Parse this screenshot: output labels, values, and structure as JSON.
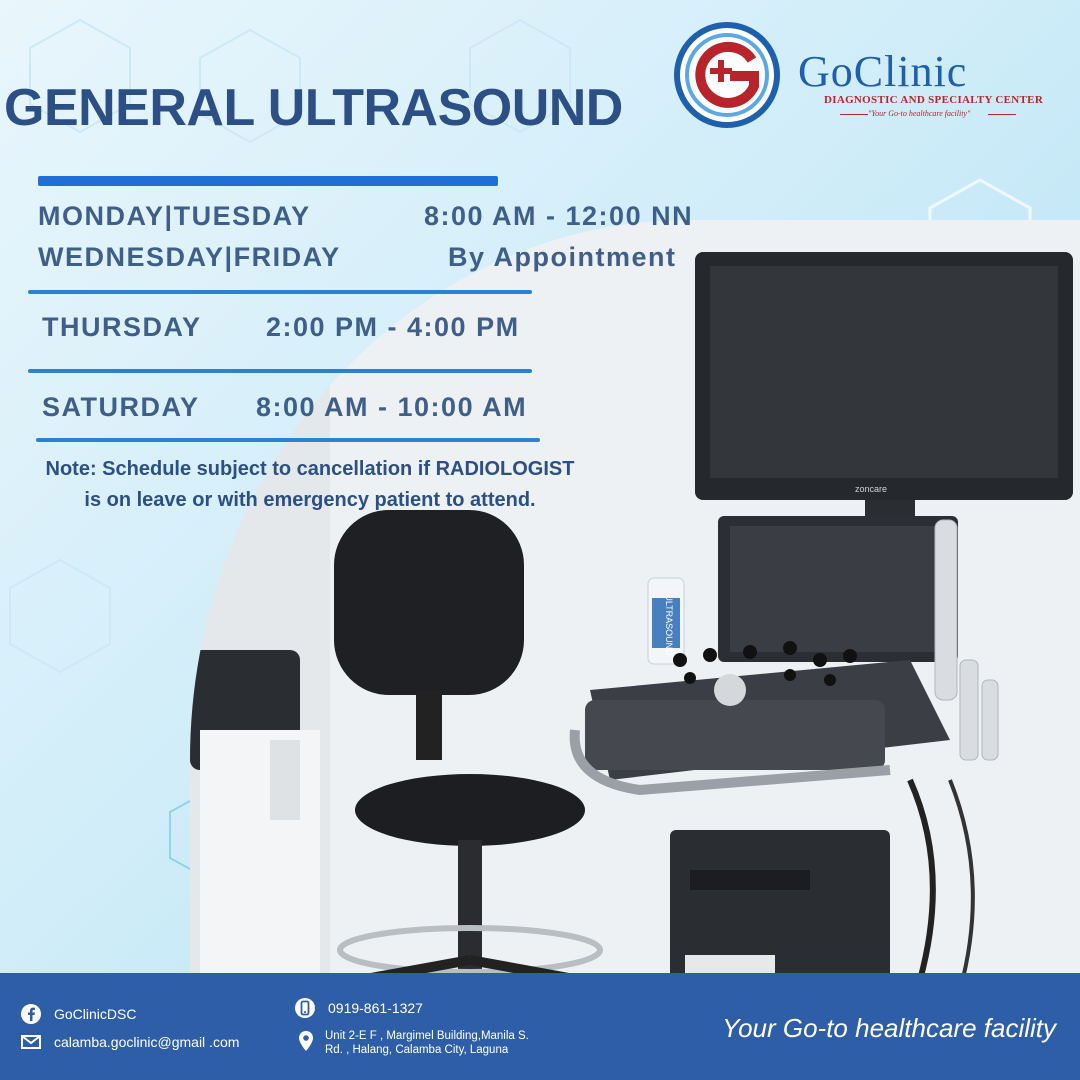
{
  "title": "GENERAL ULTRASOUND",
  "brand": {
    "name": "GoClinic",
    "subtitle": "DIAGNOSTIC AND SPECIALTY CENTER",
    "tagline": "\"Your Go-to healthcare facility\""
  },
  "schedule": [
    {
      "days": "MONDAY|TUESDAY",
      "time": "8:00 AM - 12:00 NN"
    },
    {
      "days": "WEDNESDAY|FRIDAY",
      "time": "By Appointment"
    },
    {
      "days": "THURSDAY",
      "time": "2:00 PM - 4:00 PM"
    },
    {
      "days": "SATURDAY",
      "time": "8:00 AM - 10:00 AM"
    }
  ],
  "note": {
    "line1": "Note: Schedule subject to cancellation if RADIOLOGIST",
    "line2": "is on leave or with emergency patient to attend."
  },
  "equipment_label": "ULTRASOUND",
  "monitor_brand": "zoncare",
  "footer": {
    "facebook": "GoClinicDSC",
    "email": "calamba.goclinic@gmail .com",
    "phone": "0919-861-1327",
    "address_line1": "Unit 2-E F , Margimel Building,Manila S.",
    "address_line2": "Rd. , Halang, Calamba City, Laguna",
    "slogan": "Your Go-to healthcare facility"
  },
  "colors": {
    "title": "#2c4f86",
    "accent_bar": "#1f6fd6",
    "footer": "#2e5ea8",
    "brand_blue": "#1e5fae",
    "brand_red": "#b8242c"
  },
  "icons": [
    "facebook-icon",
    "mail-icon",
    "phone-icon",
    "location-pin-icon"
  ]
}
